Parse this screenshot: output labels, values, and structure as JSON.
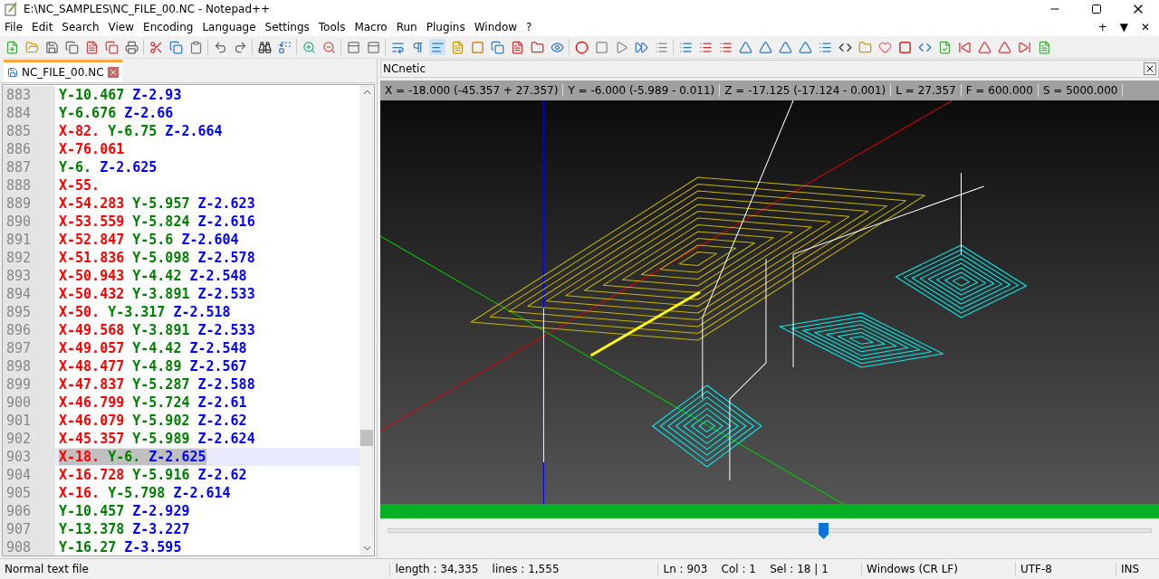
{
  "window": {
    "title": "E:\\NC_SAMPLES\\NC_FILE_00.NC - Notepad++",
    "controls": [
      "+",
      "▼",
      "✕"
    ]
  },
  "menu": [
    "File",
    "Edit",
    "Search",
    "View",
    "Encoding",
    "Language",
    "Settings",
    "Tools",
    "Macro",
    "Run",
    "Plugins",
    "Window",
    "?"
  ],
  "tabs": [
    {
      "label": "NC_FILE_00.NC",
      "selected": true
    }
  ],
  "editor": {
    "lines": [
      {
        "number": "883",
        "y": "Y-10.467",
        "z": "Z-2.93",
        "selected": false
      },
      {
        "number": "884",
        "y": "Y-6.676",
        "z": "Z-2.66",
        "selected": false
      },
      {
        "number": "885",
        "x": "X-82.",
        "y": "Y-6.75",
        "z": "Z-2.664",
        "selected": false
      },
      {
        "number": "886",
        "x": "X-76.061",
        "selected": false
      },
      {
        "number": "887",
        "y": "Y-6.",
        "z": "Z-2.625",
        "selected": false
      },
      {
        "number": "888",
        "x": "X-55.",
        "selected": false
      },
      {
        "number": "889",
        "x": "X-54.283",
        "y": "Y-5.957",
        "z": "Z-2.623",
        "selected": false
      },
      {
        "number": "890",
        "x": "X-53.559",
        "y": "Y-5.824",
        "z": "Z-2.616",
        "selected": false
      },
      {
        "number": "891",
        "x": "X-52.847",
        "y": "Y-5.6",
        "z": "Z-2.604",
        "selected": false
      },
      {
        "number": "892",
        "x": "X-51.836",
        "y": "Y-5.098",
        "z": "Z-2.578",
        "selected": false
      },
      {
        "number": "893",
        "x": "X-50.943",
        "y": "Y-4.42",
        "z": "Z-2.548",
        "selected": false
      },
      {
        "number": "894",
        "x": "X-50.432",
        "y": "Y-3.891",
        "z": "Z-2.533",
        "selected": false
      },
      {
        "number": "895",
        "x": "X-50.",
        "y": "Y-3.317",
        "z": "Z-2.518",
        "selected": false
      },
      {
        "number": "896",
        "x": "X-49.568",
        "y": "Y-3.891",
        "z": "Z-2.533",
        "selected": false
      },
      {
        "number": "897",
        "x": "X-49.057",
        "y": "Y-4.42",
        "z": "Z-2.548",
        "selected": false
      },
      {
        "number": "898",
        "x": "X-48.477",
        "y": "Y-4.89",
        "z": "Z-2.567",
        "selected": false
      },
      {
        "number": "899",
        "x": "X-47.837",
        "y": "Y-5.287",
        "z": "Z-2.588",
        "selected": false
      },
      {
        "number": "900",
        "x": "X-46.799",
        "y": "Y-5.724",
        "z": "Z-2.61",
        "selected": false
      },
      {
        "number": "901",
        "x": "X-46.079",
        "y": "Y-5.902",
        "z": "Z-2.62",
        "selected": false
      },
      {
        "number": "902",
        "x": "X-45.357",
        "y": "Y-5.989",
        "z": "Z-2.624",
        "selected": false
      },
      {
        "number": "903",
        "x": "X-18.",
        "y": "Y-6.",
        "z": "Z-2.625",
        "selected": true
      },
      {
        "number": "904",
        "x": "X-16.728",
        "y": "Y-5.916",
        "z": "Z-2.62",
        "selected": false
      },
      {
        "number": "905",
        "x": "X-16.",
        "y": "Y-5.798",
        "z": "Z-2.614",
        "selected": false
      },
      {
        "number": "906",
        "y": "Y-10.457",
        "z": "Z-2.929",
        "selected": false
      },
      {
        "number": "907",
        "y": "Y-13.378",
        "z": "Z-3.227",
        "selected": false
      },
      {
        "number": "908",
        "y": "Y-16.27",
        "z": "Z-3.595",
        "selected": false
      }
    ]
  },
  "panel": {
    "title": "NCnetic",
    "readouts": [
      "X = -18.000 (-45.357 + 27.357)",
      "Y = -6.000 (-5.989 - 0.011)",
      "Z = -17.125 (-17.124 - 0.001)",
      "L = 27.357",
      "F = 600.000",
      "S = 5000.000"
    ],
    "progress": {
      "level": 1
    },
    "slider": {
      "level": 0.57
    }
  },
  "status_bar": [
    "Normal text file",
    "length : 34,335    lines : 1,555",
    "Ln : 903    Col : 1    Sel : 18 | 1",
    "Windows (CR LF)",
    "UTF-8",
    "INS"
  ]
}
